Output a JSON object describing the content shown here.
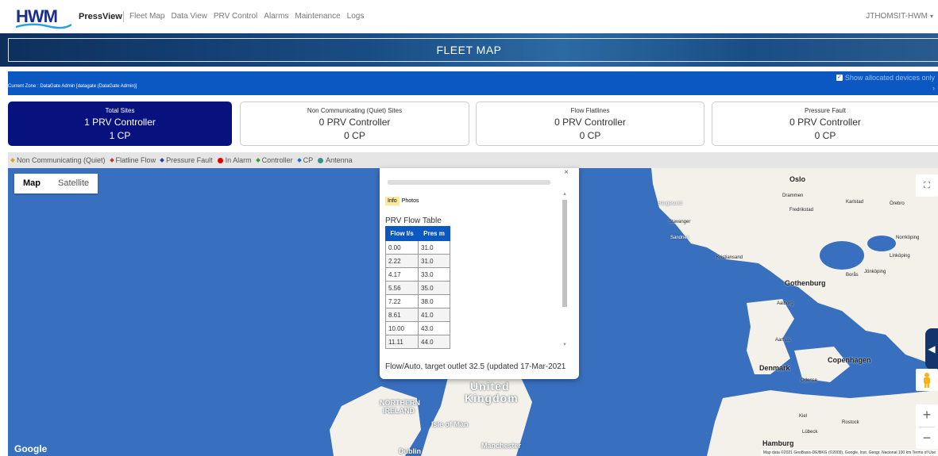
{
  "app": {
    "logo": "HWM",
    "brand": "PressView",
    "nav": [
      "Fleet Map",
      "Data View",
      "PRV Control",
      "Alarms",
      "Maintenance",
      "Logs"
    ],
    "user": "JTHOMSIT-HWM"
  },
  "banner": {
    "title": "FLEET MAP"
  },
  "zone": {
    "current": "Current Zone : DataGate Admin [datagate (DataGate Admin)]",
    "allocated_label": "Show allocated devices only",
    "allocated_checked": true
  },
  "cards": [
    {
      "title": "Total Sites",
      "line1": "1 PRV Controller",
      "line2": "1 CP",
      "active": true
    },
    {
      "title": "Non Communicating (Quiet) Sites",
      "line1": "0 PRV Controller",
      "line2": "0 CP",
      "active": false
    },
    {
      "title": "Flow Flatlines",
      "line1": "0 PRV Controller",
      "line2": "0 CP",
      "active": false
    },
    {
      "title": "Pressure Fault",
      "line1": "0 PRV Controller",
      "line2": "0 CP",
      "active": false
    }
  ],
  "legend": [
    {
      "label": "Non Communicating (Quiet)",
      "color": "#e0a020",
      "shape": "diamond"
    },
    {
      "label": "Flatline Flow",
      "color": "#c0392b",
      "shape": "diamond"
    },
    {
      "label": "Pressure Fault",
      "color": "#1b3fa6",
      "shape": "diamond"
    },
    {
      "label": "In Alarm",
      "color": "#e00000",
      "shape": "circle"
    },
    {
      "label": "Controller",
      "color": "#2aa02a",
      "shape": "diamond"
    },
    {
      "label": "CP",
      "color": "#2a6bd0",
      "shape": "diamond"
    },
    {
      "label": "Antenna",
      "color": "#3a8f8f",
      "shape": "circle"
    }
  ],
  "map": {
    "toggle": [
      "Map",
      "Satellite"
    ],
    "selected": "Map",
    "google": "Google",
    "attribution": "Map data ©2021 GeoBasis-DE/BKG (©2009), Google, Inst. Geogr. Nacional   100 km   Terms of Use",
    "labels": {
      "oslo": "Oslo",
      "drammen": "Drammen",
      "karlstad": "Karlstad",
      "orebro": "Örebro",
      "haugesund": "Haugesund",
      "fredrikstad": "Fredrikstad",
      "stavanger": "Stavanger",
      "sandnes": "Sandnes",
      "norrkoping": "Norrköping",
      "linkoping": "Linköping",
      "kristiansand": "Kristiansand",
      "boras": "Borås",
      "jonkoping": "Jönköping",
      "gothenburg": "Gothenburg",
      "aalborg": "Aalborg",
      "aarhus": "Aarhus",
      "denmark": "Denmark",
      "copenhagen": "Copenhagen",
      "odense": "Odense",
      "uk1": "United",
      "uk2": "Kingdom",
      "ni1": "NORTHERN",
      "ni2": "IRELAND",
      "isleofman": "Isle of Man",
      "kiel": "Kiel",
      "rostock": "Rostock",
      "lubeck": "Lübeck",
      "hamburg": "Hamburg",
      "manchester": "Manchester",
      "dublin": "Dublin"
    }
  },
  "popup": {
    "tabs": [
      "Info",
      "Photos"
    ],
    "selected_tab": "Info",
    "table_title": "PRV Flow Table",
    "columns": [
      "Flow l/s",
      "Pres m"
    ],
    "rows": [
      [
        "0.00",
        "31.0"
      ],
      [
        "2.22",
        "31.0"
      ],
      [
        "4.17",
        "33.0"
      ],
      [
        "5.56",
        "35.0"
      ],
      [
        "7.22",
        "38.0"
      ],
      [
        "8.61",
        "41.0"
      ],
      [
        "10.00",
        "43.0"
      ],
      [
        "11.11",
        "44.0"
      ]
    ],
    "status": "Flow/Auto, target outlet 32.5 (updated 17-Mar-2021"
  }
}
